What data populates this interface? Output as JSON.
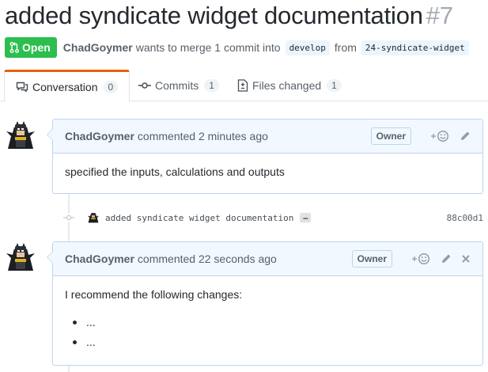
{
  "pr": {
    "title": "added syndicate widget documentation",
    "number": "#7",
    "state_label": "Open",
    "author": "ChadGoymer",
    "merge_text": "wants to merge 1 commit into",
    "base_branch": "develop",
    "from_text": "from",
    "head_branch": "24-syndicate-widget"
  },
  "tabs": [
    {
      "label": "Conversation",
      "count": "0",
      "icon": "comment-discussion-icon",
      "selected": true
    },
    {
      "label": "Commits",
      "count": "1",
      "icon": "git-commit-icon"
    },
    {
      "label": "Files changed",
      "count": "1",
      "icon": "file-diff-icon"
    }
  ],
  "comments": [
    {
      "author": "ChadGoymer",
      "action": "commented 2 minutes ago",
      "badge": "Owner",
      "body": "specified the inputs, calculations and outputs"
    },
    {
      "author": "ChadGoymer",
      "action": "commented 22 seconds ago",
      "badge": "Owner",
      "body": "I recommend the following changes:",
      "list": [
        "...",
        "..."
      ]
    }
  ],
  "commit": {
    "message": "added syndicate widget documentation",
    "ellipsis": "…",
    "sha": "88c00d1"
  },
  "colors": {
    "open_green": "#2cbe4e",
    "selected_tab_accent": "#e36209",
    "comment_header_bg": "#f1f8ff",
    "comment_border": "#c0d3eb"
  }
}
